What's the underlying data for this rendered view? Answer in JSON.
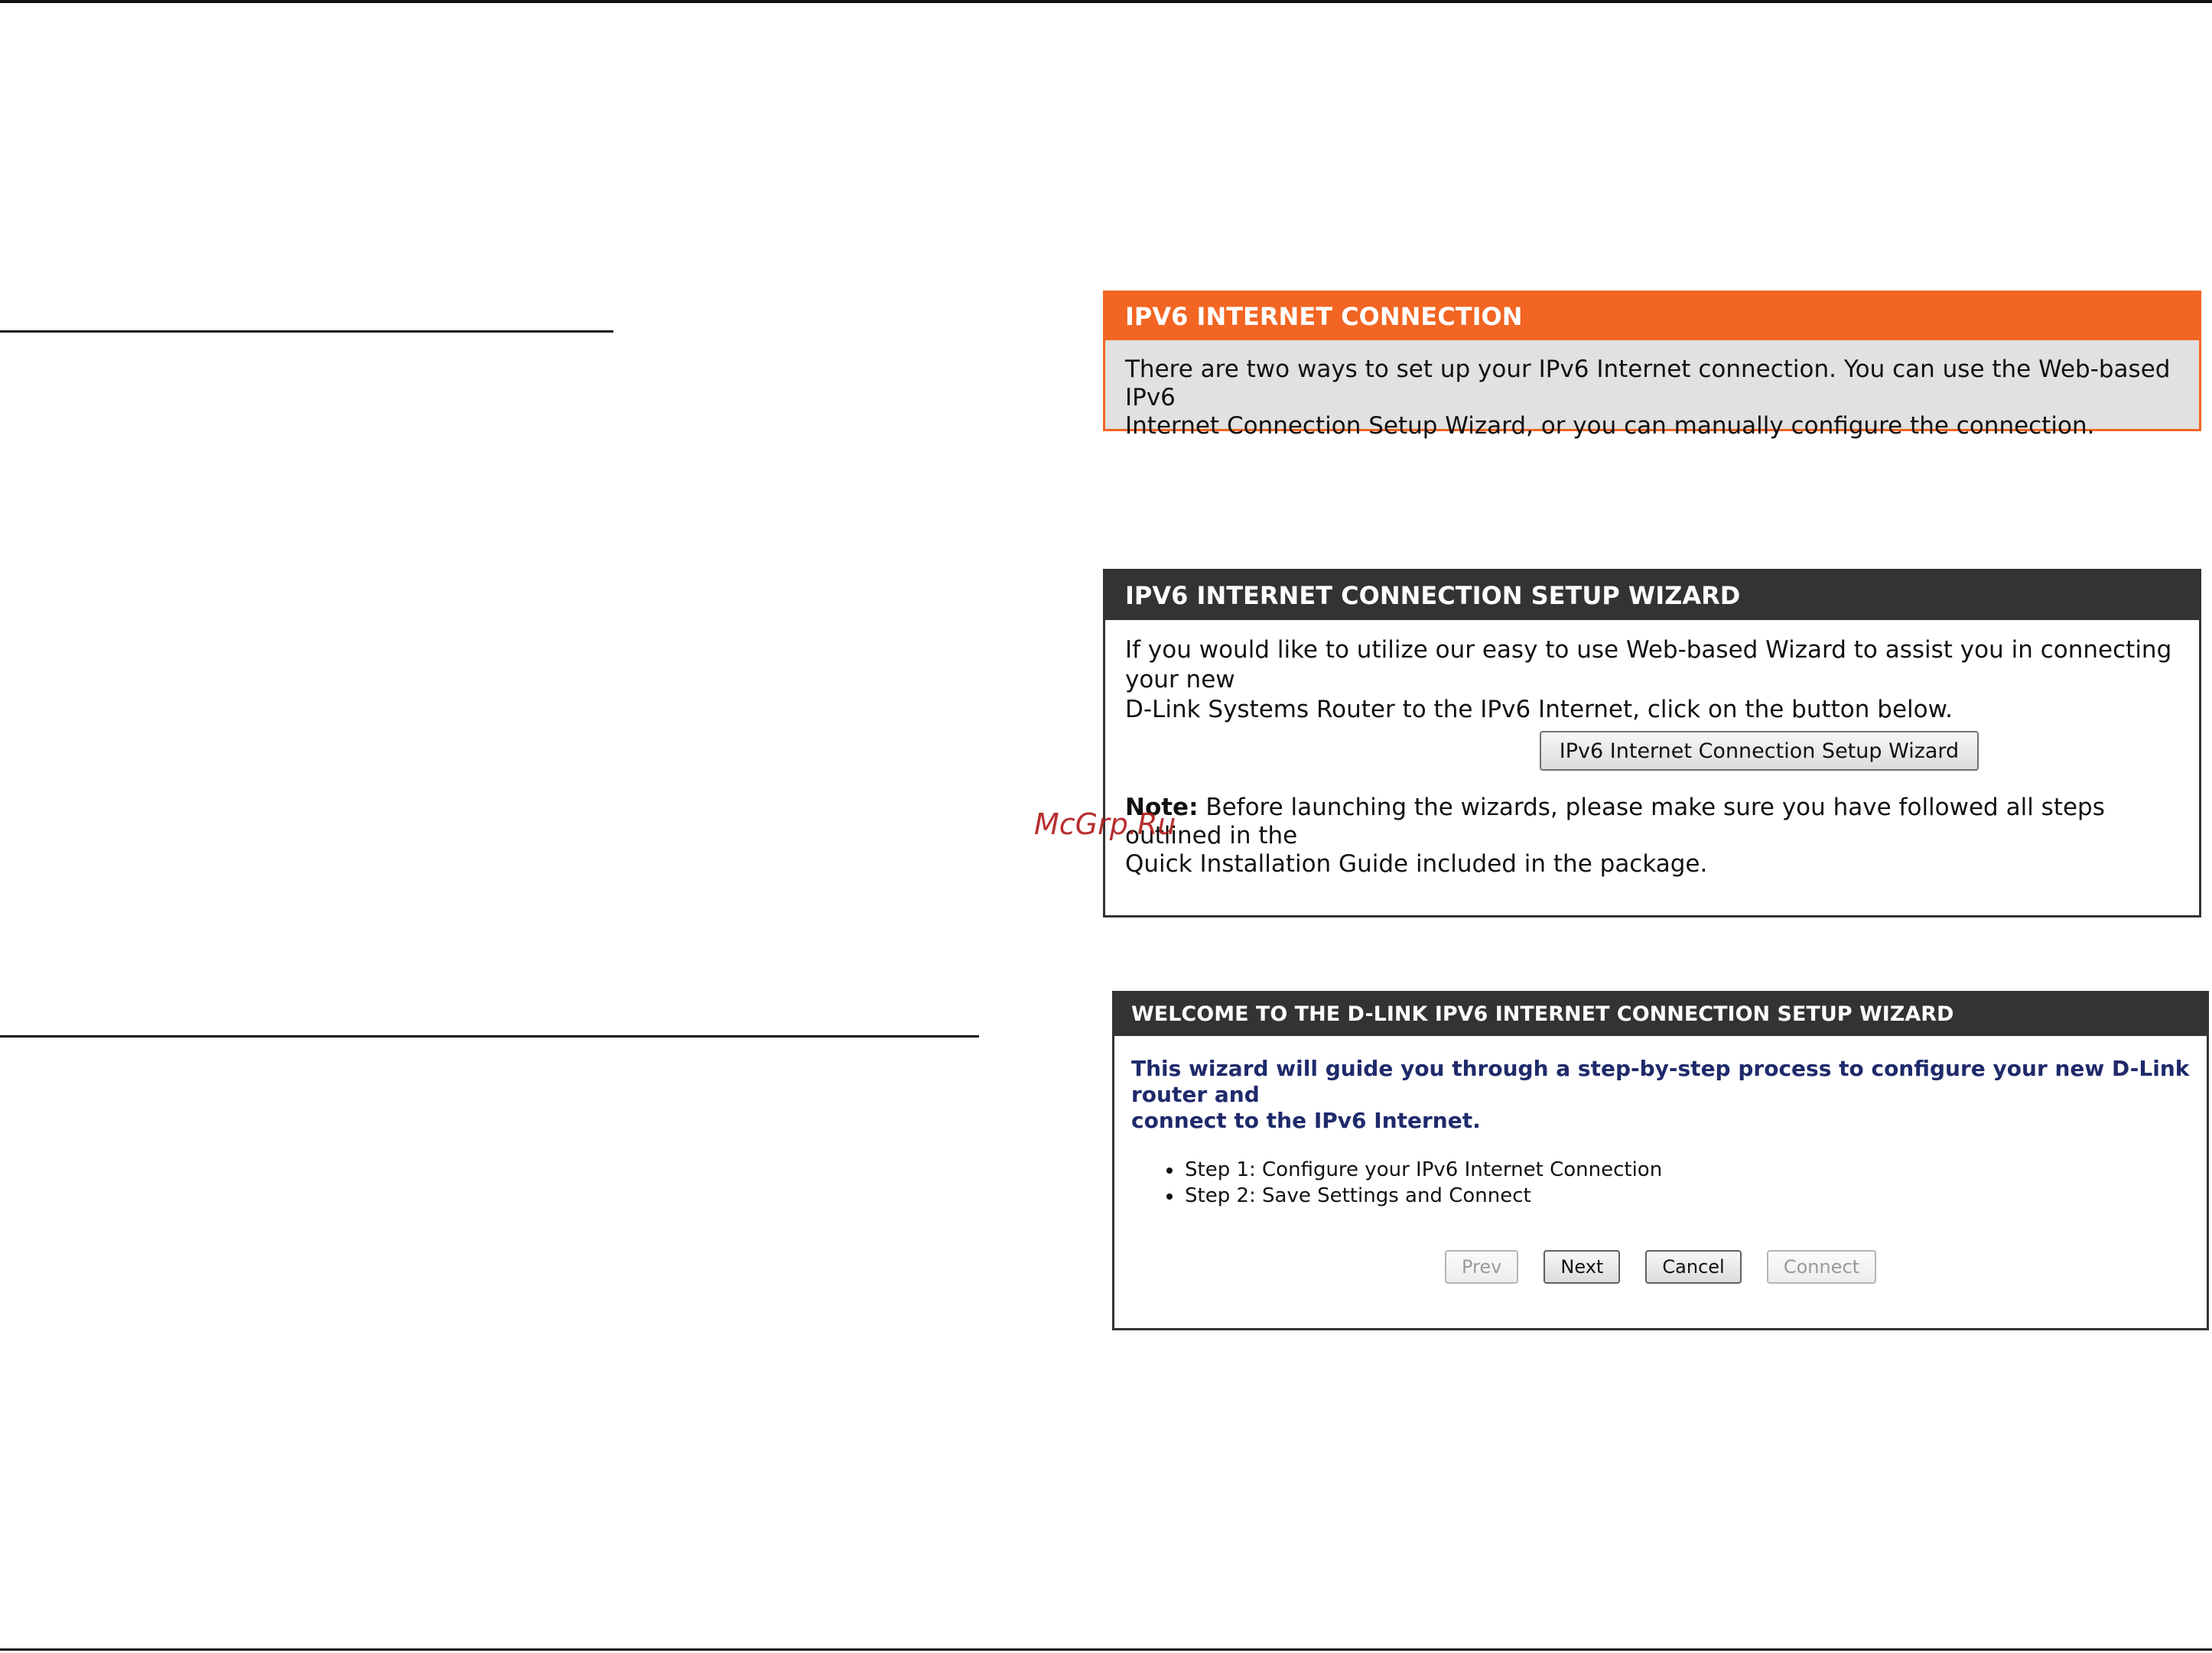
{
  "connection_panel": {
    "title": "IPV6 INTERNET CONNECTION",
    "line1": "There are two ways to set up your IPv6 Internet connection. You can use the Web-based IPv6",
    "line2": "Internet Connection Setup Wizard, or you can manually configure the connection."
  },
  "wizard_panel": {
    "title": "IPV6 INTERNET CONNECTION SETUP WIZARD",
    "line1": "If you would like to utilize our easy to use Web-based Wizard to assist you in connecting your new",
    "line2": "D-Link Systems Router to the IPv6 Internet, click on the button below.",
    "button_label": "IPv6 Internet Connection Setup Wizard",
    "note_label": "Note:",
    "note_line1": " Before launching the wizards, please make sure you have followed all steps outlined in the",
    "note_line2": "Quick Installation Guide included in the package."
  },
  "welcome_panel": {
    "title": "WELCOME TO THE D-LINK IPV6 INTERNET CONNECTION SETUP WIZARD",
    "lead_line1": "This wizard will guide you through a step-by-step process to configure your new D-Link router and",
    "lead_line2": "connect to the IPv6 Internet.",
    "steps": [
      "Step 1: Configure your IPv6 Internet Connection",
      "Step 2: Save Settings and Connect"
    ],
    "buttons": {
      "prev": "Prev",
      "next": "Next",
      "cancel": "Cancel",
      "connect": "Connect"
    }
  },
  "watermark": "McGrp.Ru",
  "colors": {
    "accent_orange": "#f26522",
    "header_dark": "#333333",
    "lead_blue": "#1f2a6b"
  }
}
